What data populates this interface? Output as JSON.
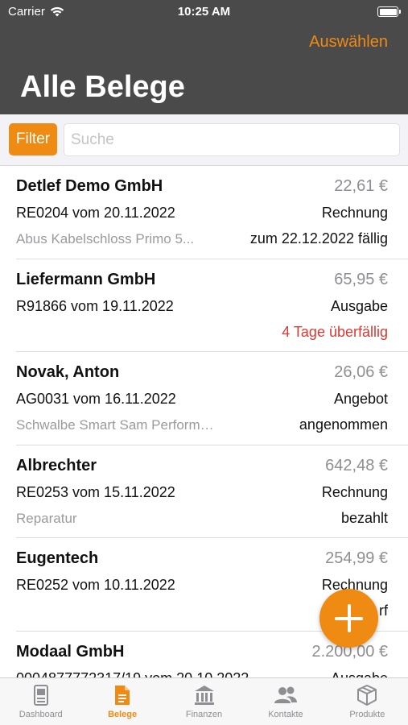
{
  "status_bar": {
    "carrier": "Carrier",
    "time": "10:25 AM"
  },
  "header": {
    "select_label": "Auswählen",
    "title": "Alle Belege"
  },
  "search": {
    "filter_label": "Filter",
    "placeholder": "Suche"
  },
  "receipts": [
    {
      "name": "Detlef Demo GmbH",
      "amount": "22,61 €",
      "number": "RE0204 vom 20.11.2022",
      "type": "Rechnung",
      "description": "Abus Kabelschloss Primo 5...",
      "status": "zum 22.12.2022 fällig",
      "status_color": "#111111"
    },
    {
      "name": "Liefermann GmbH",
      "amount": "65,95 €",
      "number": "R91866 vom 19.11.2022",
      "type": "Ausgabe",
      "description": "",
      "status": "4 Tage überfällig",
      "status_color": "#d93a33"
    },
    {
      "name": "Novak, Anton",
      "amount": "26,06 €",
      "number": "AG0031 vom 16.11.2022",
      "type": "Angebot",
      "description": "Schwalbe Smart Sam Performance...",
      "status": "angenommen",
      "status_color": "#111111"
    },
    {
      "name": "Albrechter",
      "amount": "642,48 €",
      "number": "RE0253 vom 15.11.2022",
      "type": "Rechnung",
      "description": "Reparatur",
      "status": "bezahlt",
      "status_color": "#111111"
    },
    {
      "name": "Eugentech",
      "amount": "254,99 €",
      "number": "RE0252 vom 10.11.2022",
      "type": "Rechnung",
      "description": "",
      "status": "rf",
      "status_color": "#111111"
    },
    {
      "name": "Modaal GmbH",
      "amount": "2.200,00 €",
      "number": "0004877772317/19 vom 20.10.2022",
      "type": "Ausgabe",
      "description": "",
      "status": "",
      "status_color": "#111111"
    }
  ],
  "tabs": [
    {
      "label": "Dashboard",
      "icon": "dashboard-icon",
      "active": false
    },
    {
      "label": "Belege",
      "icon": "document-icon",
      "active": true
    },
    {
      "label": "Finanzen",
      "icon": "bank-icon",
      "active": false
    },
    {
      "label": "Kontakte",
      "icon": "contacts-icon",
      "active": false
    },
    {
      "label": "Produkte",
      "icon": "box-icon",
      "active": false
    }
  ],
  "colors": {
    "accent": "#ef8a13",
    "header_bg": "#4a4a4a",
    "overdue": "#d93a33"
  }
}
